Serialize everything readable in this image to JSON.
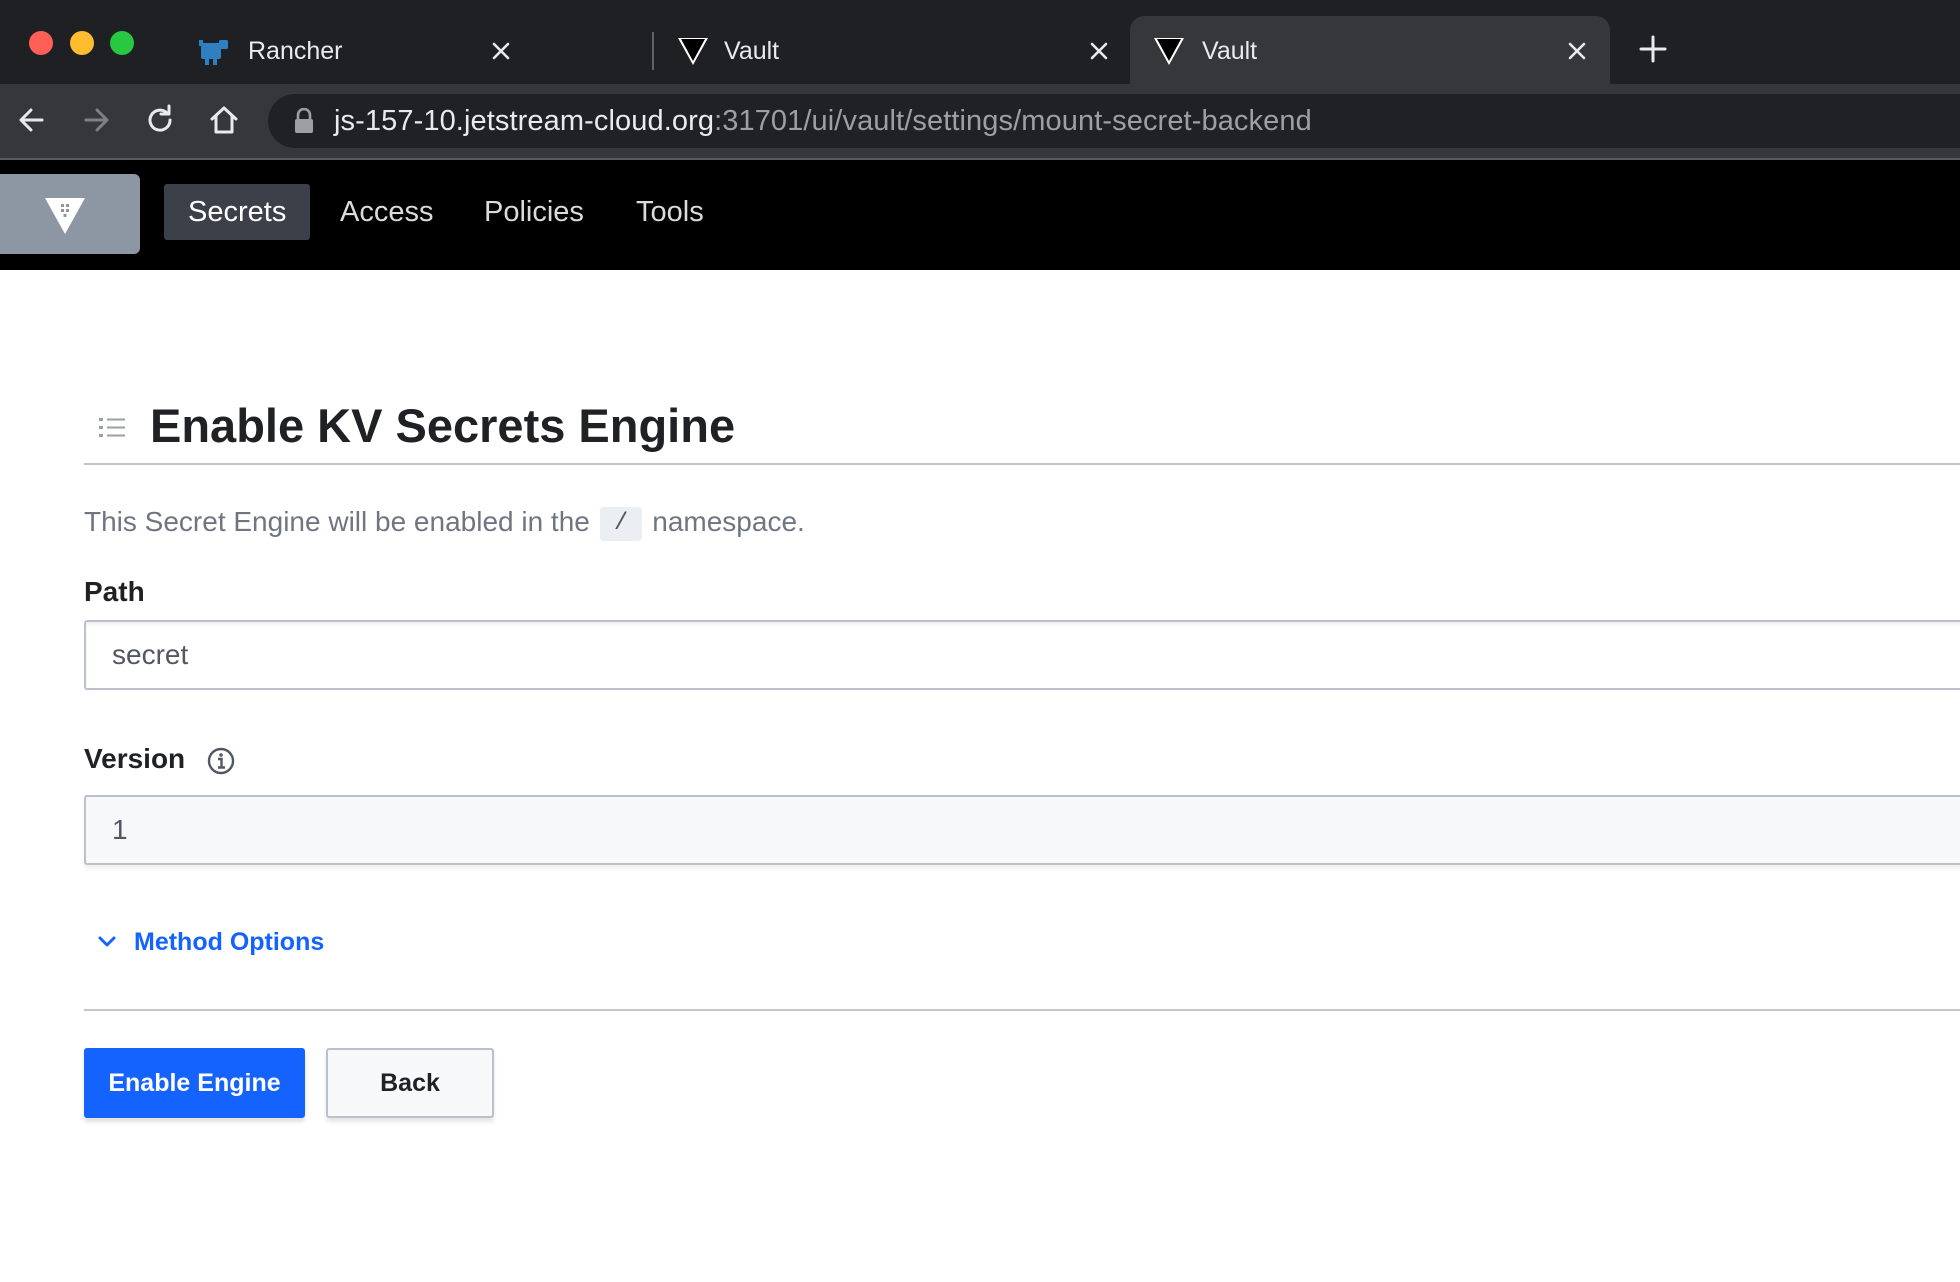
{
  "browser": {
    "tabs": [
      {
        "title": "Rancher",
        "favicon": "rancher-icon",
        "active": false
      },
      {
        "title": "Vault",
        "favicon": "vault-icon",
        "active": false
      },
      {
        "title": "Vault",
        "favicon": "vault-icon",
        "active": true
      }
    ],
    "url": {
      "host": "js-157-10.jetstream-cloud.org",
      "path": ":31701/ui/vault/settings/mount-secret-backend"
    }
  },
  "nav": {
    "items": [
      {
        "label": "Secrets",
        "active": true
      },
      {
        "label": "Access",
        "active": false
      },
      {
        "label": "Policies",
        "active": false
      },
      {
        "label": "Tools",
        "active": false
      }
    ]
  },
  "page": {
    "title": "Enable KV Secrets Engine",
    "namespace_prefix": "This Secret Engine will be enabled in the",
    "namespace_value": "/",
    "namespace_suffix": "namespace.",
    "path_label": "Path",
    "path_value": "secret",
    "version_label": "Version",
    "version_value": "1",
    "method_options_label": "Method Options",
    "enable_button": "Enable Engine",
    "back_button": "Back"
  },
  "colors": {
    "accent": "#1563ff",
    "nav_background": "#000000",
    "logo_background": "#8d96a3"
  }
}
